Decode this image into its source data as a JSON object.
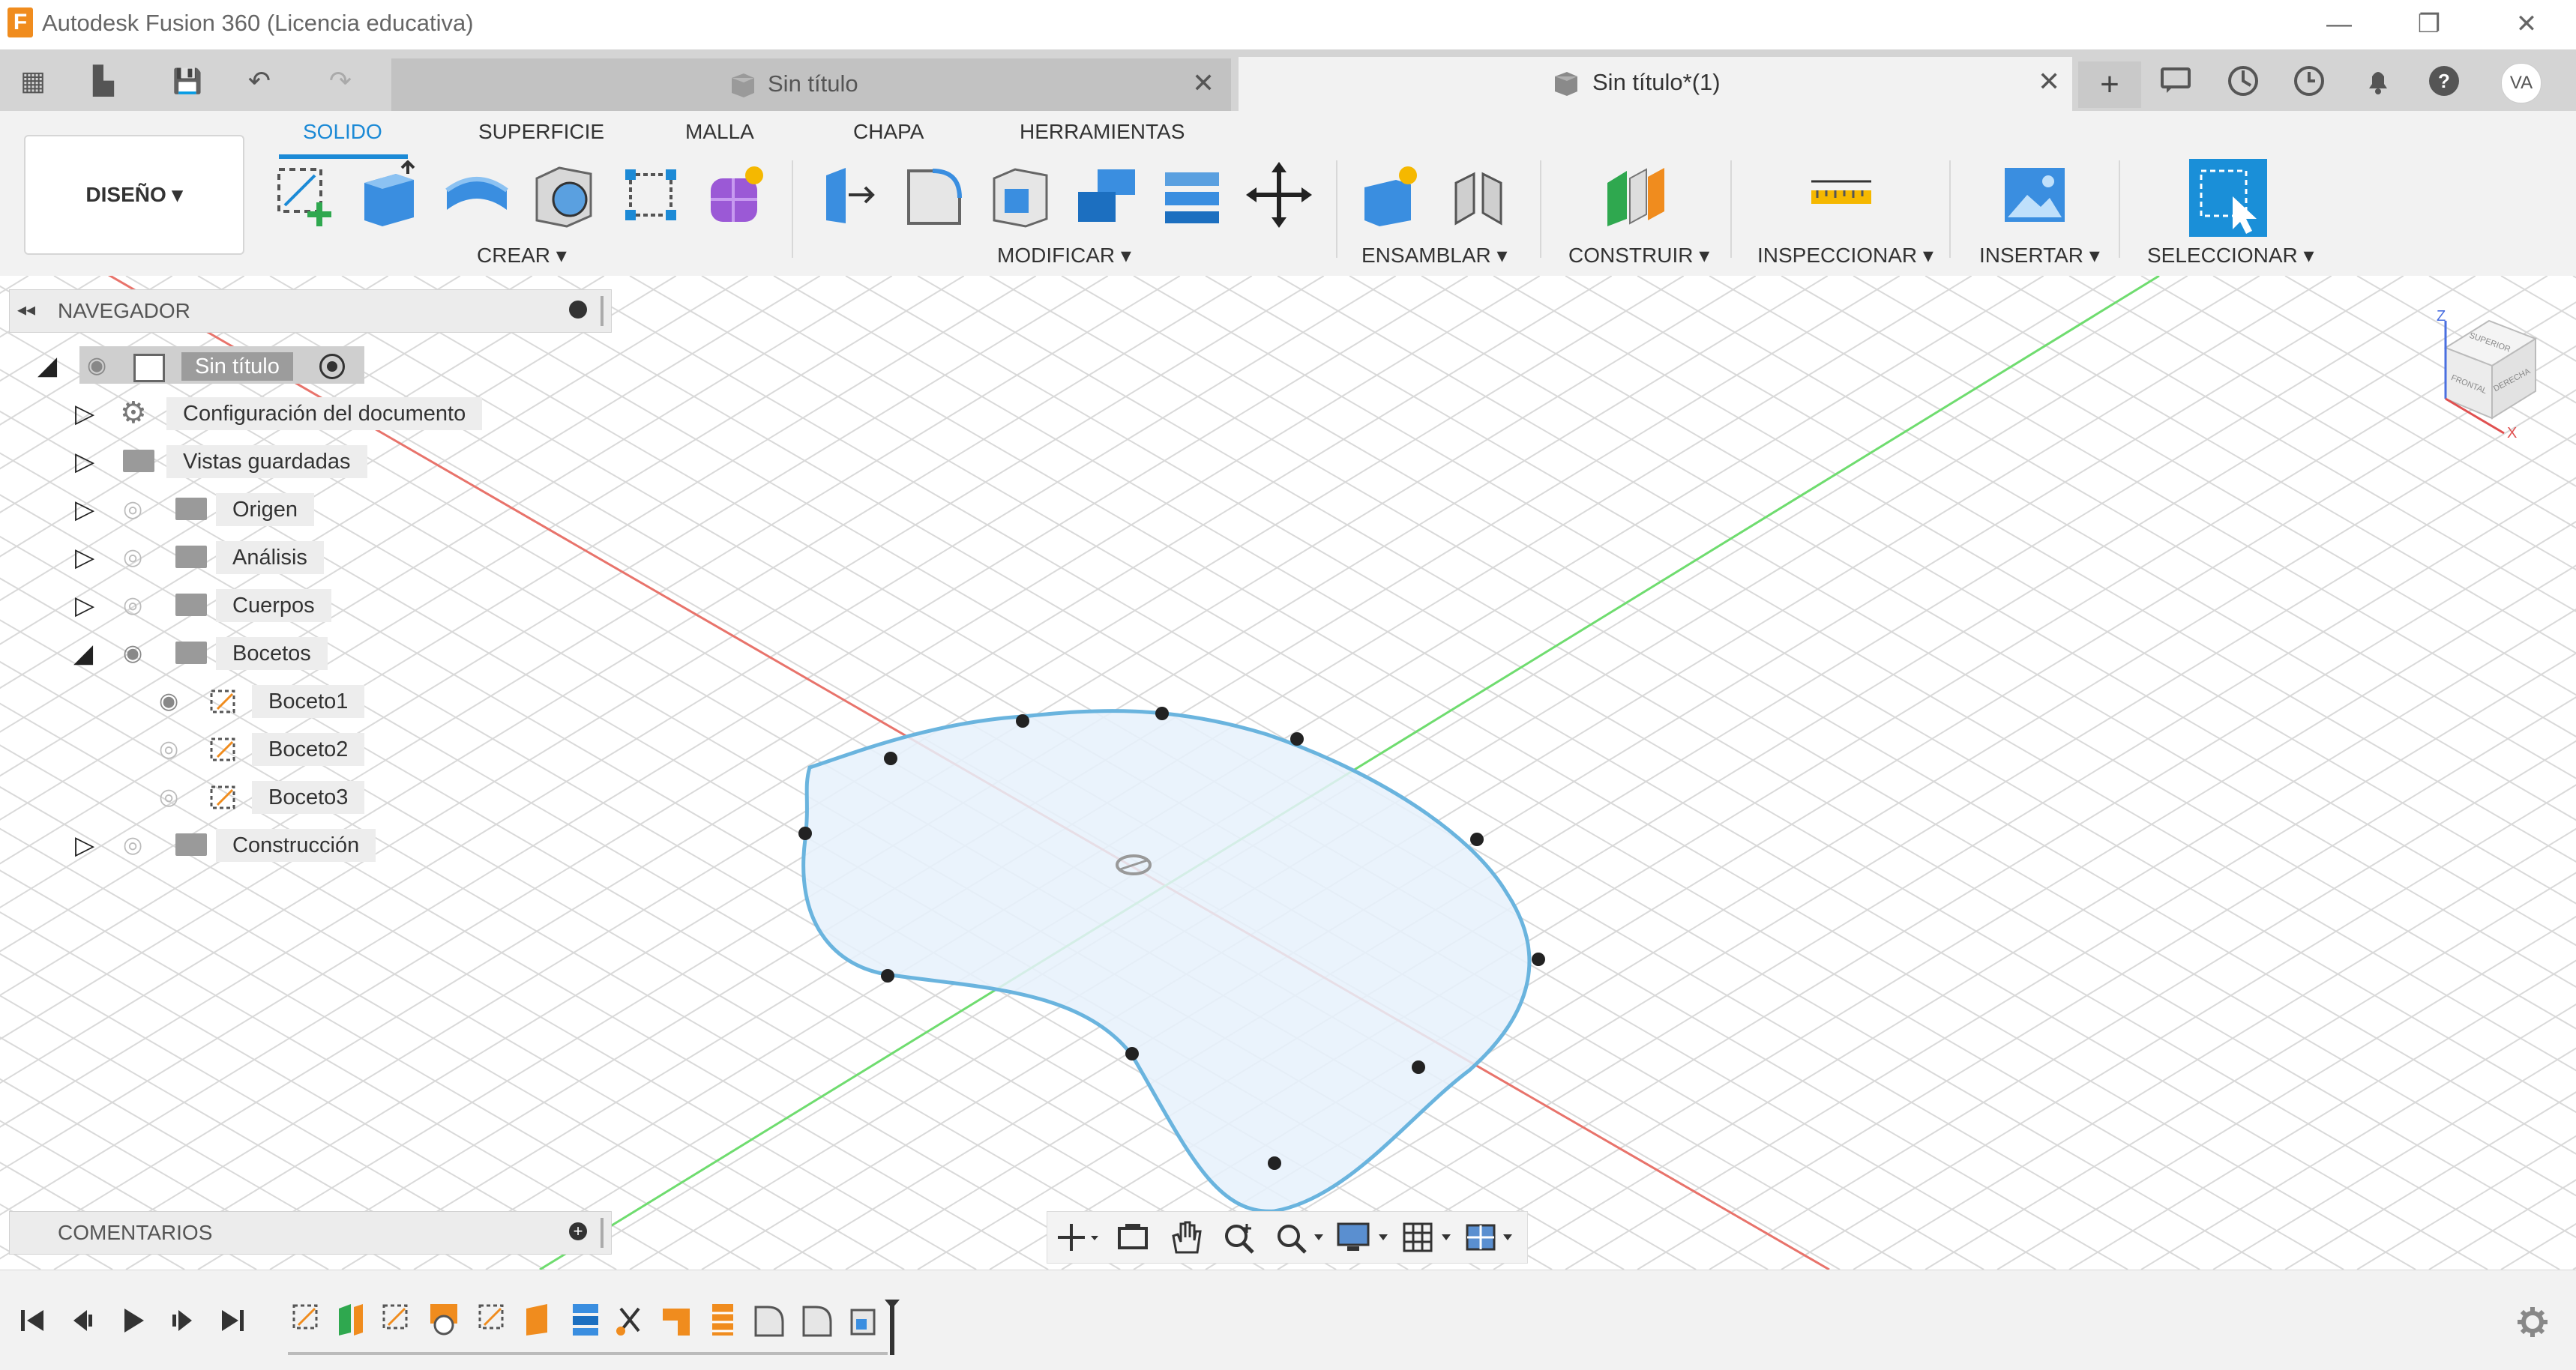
{
  "app": {
    "logo_letter": "F",
    "title": "Autodesk Fusion 360 (Licencia educativa)"
  },
  "window_controls": {
    "minimize": "—",
    "restore": "❐",
    "close": "✕"
  },
  "tabbar": {
    "grid_icon": "▦",
    "file_icon": "▙",
    "save_icon": "💾",
    "undo_icon": "↶",
    "redo_icon": "↷",
    "tabs": [
      {
        "label": "Sin título",
        "close": "✕"
      },
      {
        "label": "Sin título*(1)",
        "close": "✕"
      }
    ],
    "add_tab": "+",
    "user_initials": "VA"
  },
  "ribbon": {
    "workspace": "DISEÑO ▾",
    "tabs": [
      "SOLIDO",
      "SUPERFICIE",
      "MALLA",
      "CHAPA",
      "HERRAMIENTAS"
    ],
    "groups": [
      "CREAR ▾",
      "MODIFICAR ▾",
      "ENSAMBLAR ▾",
      "CONSTRUIR ▾",
      "INSPECCIONAR ▾",
      "INSERTAR ▾",
      "SELECCIONAR ▾"
    ]
  },
  "navigator": {
    "title": "NAVEGADOR",
    "root": "Sin título",
    "items": [
      {
        "label": "Configuración del documento"
      },
      {
        "label": "Vistas guardadas"
      },
      {
        "label": "Origen"
      },
      {
        "label": "Análisis"
      },
      {
        "label": "Cuerpos"
      },
      {
        "label": "Bocetos"
      },
      {
        "label": "Boceto1"
      },
      {
        "label": "Boceto2"
      },
      {
        "label": "Boceto3"
      },
      {
        "label": "Construcción"
      }
    ]
  },
  "comments": {
    "title": "COMENTARIOS"
  },
  "viewcube": {
    "top": "SUPERIOR",
    "front": "FRONTAL",
    "right": "DERECHA",
    "axes": [
      "Z",
      "X"
    ]
  },
  "colors": {
    "accent": "#1c8ad6",
    "x_axis": "#e8736b",
    "y_axis": "#6fdc6f",
    "sketch_fill": "#e6f1fb",
    "sketch_stroke": "#6ab4de"
  }
}
